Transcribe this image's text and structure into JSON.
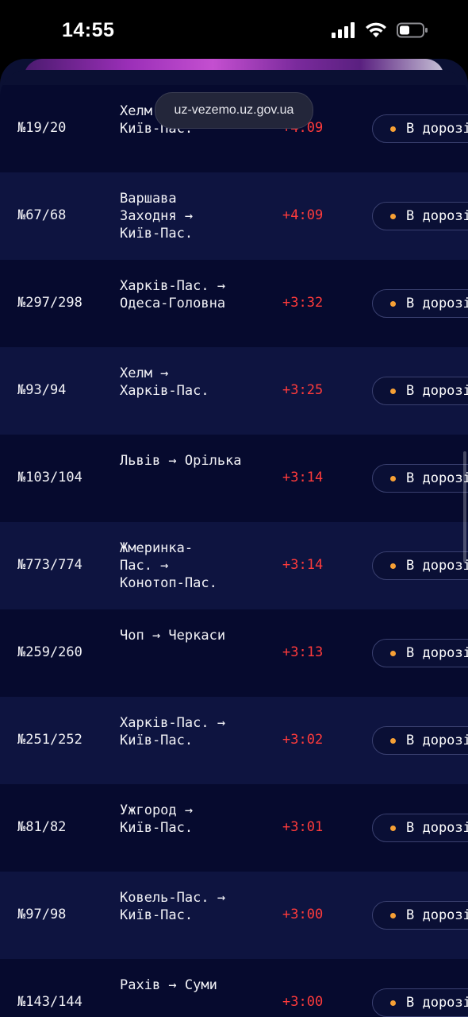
{
  "status_bar": {
    "time": "14:55"
  },
  "browser": {
    "url": "uz-vezemo.uz.gov.ua"
  },
  "colors": {
    "delay": "#ff3b3b",
    "status_dot": "#f7a035",
    "row_dark": "#060a2e",
    "row_light": "#0e1440"
  },
  "trains": [
    {
      "number": "№19/20",
      "route": "Хелм\nКиїв-Пас.",
      "delay": "+4:09",
      "status": "В дорозі"
    },
    {
      "number": "№67/68",
      "route": "Варшава\nЗаходня →\nКиїв-Пас.",
      "delay": "+4:09",
      "status": "В дорозі"
    },
    {
      "number": "№297/298",
      "route": "Харків-Пас. →\nОдеса-Головна",
      "delay": "+3:32",
      "status": "В дорозі"
    },
    {
      "number": "№93/94",
      "route": "Хелм →\nХарків-Пас.",
      "delay": "+3:25",
      "status": "В дорозі"
    },
    {
      "number": "№103/104",
      "route": "Львів → Орілька",
      "delay": "+3:14",
      "status": "В дорозі"
    },
    {
      "number": "№773/774",
      "route": "Жмеринка-\nПас. →\nКонотоп-Пас.",
      "delay": "+3:14",
      "status": "В дорозі"
    },
    {
      "number": "№259/260",
      "route": "Чоп → Черкаси",
      "delay": "+3:13",
      "status": "В дорозі"
    },
    {
      "number": "№251/252",
      "route": "Харків-Пас. →\nКиїв-Пас.",
      "delay": "+3:02",
      "status": "В дорозі"
    },
    {
      "number": "№81/82",
      "route": "Ужгород →\nКиїв-Пас.",
      "delay": "+3:01",
      "status": "В дорозі"
    },
    {
      "number": "№97/98",
      "route": "Ковель-Пас. →\nКиїв-Пас.",
      "delay": "+3:00",
      "status": "В дорозі"
    },
    {
      "number": "№143/144",
      "route": "Рахів → Суми",
      "delay": "+3:00",
      "status": "В дорозі"
    }
  ]
}
